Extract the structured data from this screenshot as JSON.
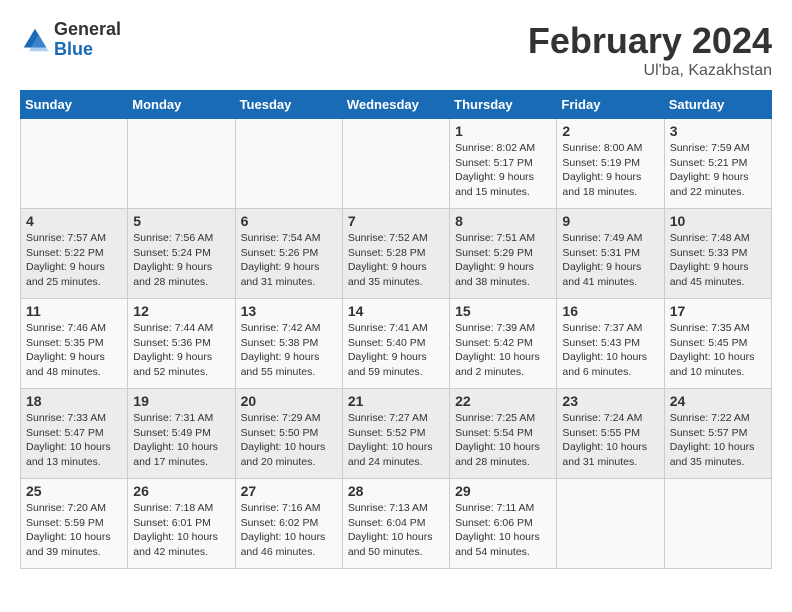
{
  "header": {
    "logo_general": "General",
    "logo_blue": "Blue",
    "month_title": "February 2024",
    "location": "Ul'ba, Kazakhstan"
  },
  "days_of_week": [
    "Sunday",
    "Monday",
    "Tuesday",
    "Wednesday",
    "Thursday",
    "Friday",
    "Saturday"
  ],
  "weeks": [
    [
      {
        "day": "",
        "info": ""
      },
      {
        "day": "",
        "info": ""
      },
      {
        "day": "",
        "info": ""
      },
      {
        "day": "",
        "info": ""
      },
      {
        "day": "1",
        "info": "Sunrise: 8:02 AM\nSunset: 5:17 PM\nDaylight: 9 hours\nand 15 minutes."
      },
      {
        "day": "2",
        "info": "Sunrise: 8:00 AM\nSunset: 5:19 PM\nDaylight: 9 hours\nand 18 minutes."
      },
      {
        "day": "3",
        "info": "Sunrise: 7:59 AM\nSunset: 5:21 PM\nDaylight: 9 hours\nand 22 minutes."
      }
    ],
    [
      {
        "day": "4",
        "info": "Sunrise: 7:57 AM\nSunset: 5:22 PM\nDaylight: 9 hours\nand 25 minutes."
      },
      {
        "day": "5",
        "info": "Sunrise: 7:56 AM\nSunset: 5:24 PM\nDaylight: 9 hours\nand 28 minutes."
      },
      {
        "day": "6",
        "info": "Sunrise: 7:54 AM\nSunset: 5:26 PM\nDaylight: 9 hours\nand 31 minutes."
      },
      {
        "day": "7",
        "info": "Sunrise: 7:52 AM\nSunset: 5:28 PM\nDaylight: 9 hours\nand 35 minutes."
      },
      {
        "day": "8",
        "info": "Sunrise: 7:51 AM\nSunset: 5:29 PM\nDaylight: 9 hours\nand 38 minutes."
      },
      {
        "day": "9",
        "info": "Sunrise: 7:49 AM\nSunset: 5:31 PM\nDaylight: 9 hours\nand 41 minutes."
      },
      {
        "day": "10",
        "info": "Sunrise: 7:48 AM\nSunset: 5:33 PM\nDaylight: 9 hours\nand 45 minutes."
      }
    ],
    [
      {
        "day": "11",
        "info": "Sunrise: 7:46 AM\nSunset: 5:35 PM\nDaylight: 9 hours\nand 48 minutes."
      },
      {
        "day": "12",
        "info": "Sunrise: 7:44 AM\nSunset: 5:36 PM\nDaylight: 9 hours\nand 52 minutes."
      },
      {
        "day": "13",
        "info": "Sunrise: 7:42 AM\nSunset: 5:38 PM\nDaylight: 9 hours\nand 55 minutes."
      },
      {
        "day": "14",
        "info": "Sunrise: 7:41 AM\nSunset: 5:40 PM\nDaylight: 9 hours\nand 59 minutes."
      },
      {
        "day": "15",
        "info": "Sunrise: 7:39 AM\nSunset: 5:42 PM\nDaylight: 10 hours\nand 2 minutes."
      },
      {
        "day": "16",
        "info": "Sunrise: 7:37 AM\nSunset: 5:43 PM\nDaylight: 10 hours\nand 6 minutes."
      },
      {
        "day": "17",
        "info": "Sunrise: 7:35 AM\nSunset: 5:45 PM\nDaylight: 10 hours\nand 10 minutes."
      }
    ],
    [
      {
        "day": "18",
        "info": "Sunrise: 7:33 AM\nSunset: 5:47 PM\nDaylight: 10 hours\nand 13 minutes."
      },
      {
        "day": "19",
        "info": "Sunrise: 7:31 AM\nSunset: 5:49 PM\nDaylight: 10 hours\nand 17 minutes."
      },
      {
        "day": "20",
        "info": "Sunrise: 7:29 AM\nSunset: 5:50 PM\nDaylight: 10 hours\nand 20 minutes."
      },
      {
        "day": "21",
        "info": "Sunrise: 7:27 AM\nSunset: 5:52 PM\nDaylight: 10 hours\nand 24 minutes."
      },
      {
        "day": "22",
        "info": "Sunrise: 7:25 AM\nSunset: 5:54 PM\nDaylight: 10 hours\nand 28 minutes."
      },
      {
        "day": "23",
        "info": "Sunrise: 7:24 AM\nSunset: 5:55 PM\nDaylight: 10 hours\nand 31 minutes."
      },
      {
        "day": "24",
        "info": "Sunrise: 7:22 AM\nSunset: 5:57 PM\nDaylight: 10 hours\nand 35 minutes."
      }
    ],
    [
      {
        "day": "25",
        "info": "Sunrise: 7:20 AM\nSunset: 5:59 PM\nDaylight: 10 hours\nand 39 minutes."
      },
      {
        "day": "26",
        "info": "Sunrise: 7:18 AM\nSunset: 6:01 PM\nDaylight: 10 hours\nand 42 minutes."
      },
      {
        "day": "27",
        "info": "Sunrise: 7:16 AM\nSunset: 6:02 PM\nDaylight: 10 hours\nand 46 minutes."
      },
      {
        "day": "28",
        "info": "Sunrise: 7:13 AM\nSunset: 6:04 PM\nDaylight: 10 hours\nand 50 minutes."
      },
      {
        "day": "29",
        "info": "Sunrise: 7:11 AM\nSunset: 6:06 PM\nDaylight: 10 hours\nand 54 minutes."
      },
      {
        "day": "",
        "info": ""
      },
      {
        "day": "",
        "info": ""
      }
    ]
  ]
}
